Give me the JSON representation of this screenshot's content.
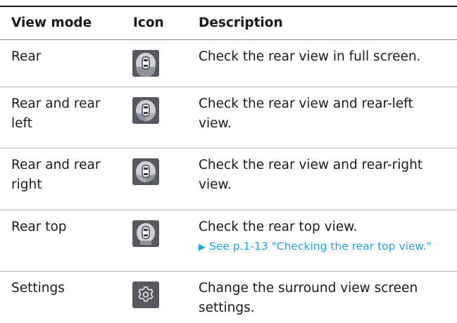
{
  "table": {
    "headers": {
      "view_mode": "View mode",
      "icon": "Icon",
      "description": "Description"
    },
    "rows": [
      {
        "mode": "Rear",
        "icon": "rear-view-icon",
        "description": "Check the rear view in full screen."
      },
      {
        "mode": "Rear and rear left",
        "icon": "rear-and-rear-left-view-icon",
        "description": "Check the rear view and rear-left view."
      },
      {
        "mode": "Rear and rear right",
        "icon": "rear-and-rear-right-view-icon",
        "description": "Check the rear view and rear-right view."
      },
      {
        "mode": "Rear top",
        "icon": "rear-top-view-icon",
        "description": "Check the rear top view.",
        "link_arrow": "▶",
        "link_text": "See p.1-13 \"Checking the rear top view.\""
      },
      {
        "mode": "Settings",
        "icon": "settings-gear-icon",
        "description": "Change the surround view screen settings."
      }
    ]
  },
  "colors": {
    "link": "#1aa5e0",
    "icon_bg": "#565a60",
    "rule": "#1a1a1a"
  }
}
